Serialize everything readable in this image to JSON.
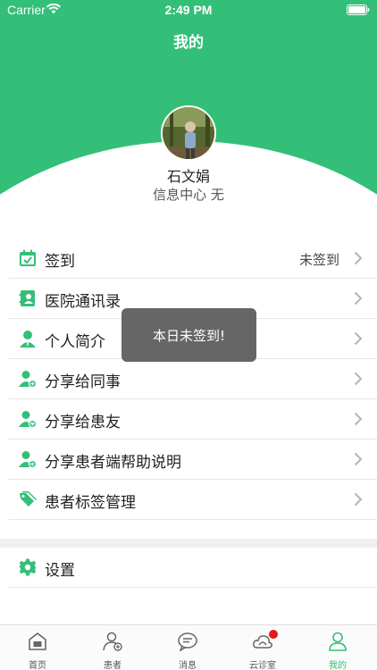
{
  "status_bar": {
    "carrier": "Carrier",
    "time": "2:49 PM"
  },
  "nav": {
    "title": "我的"
  },
  "profile": {
    "name": "石文娟",
    "department": "信息中心 无"
  },
  "menu": [
    {
      "label": "签到",
      "value": "未签到",
      "icon": "calendar-check-icon"
    },
    {
      "label": "医院通讯录",
      "value": "",
      "icon": "contacts-book-icon"
    },
    {
      "label": "个人简介",
      "value": "",
      "icon": "user-profile-icon"
    },
    {
      "label": "分享给同事",
      "value": "",
      "icon": "share-colleague-icon"
    },
    {
      "label": "分享给患友",
      "value": "",
      "icon": "share-patient-icon"
    },
    {
      "label": "分享患者端帮助说明",
      "value": "",
      "icon": "share-help-icon"
    },
    {
      "label": "患者标签管理",
      "value": "",
      "icon": "tag-icon"
    }
  ],
  "settings": {
    "label": "设置",
    "icon": "settings-gear-icon"
  },
  "toast": {
    "text": "本日未签到!"
  },
  "tabbar": [
    {
      "label": "首页",
      "icon": "home-icon"
    },
    {
      "label": "患者",
      "icon": "patient-icon"
    },
    {
      "label": "消息",
      "icon": "message-icon"
    },
    {
      "label": "云诊室",
      "icon": "cloud-clinic-icon"
    },
    {
      "label": "我的",
      "icon": "me-icon",
      "active": true
    }
  ],
  "colors": {
    "brand": "#33bf78",
    "badge": "#e8151b"
  }
}
